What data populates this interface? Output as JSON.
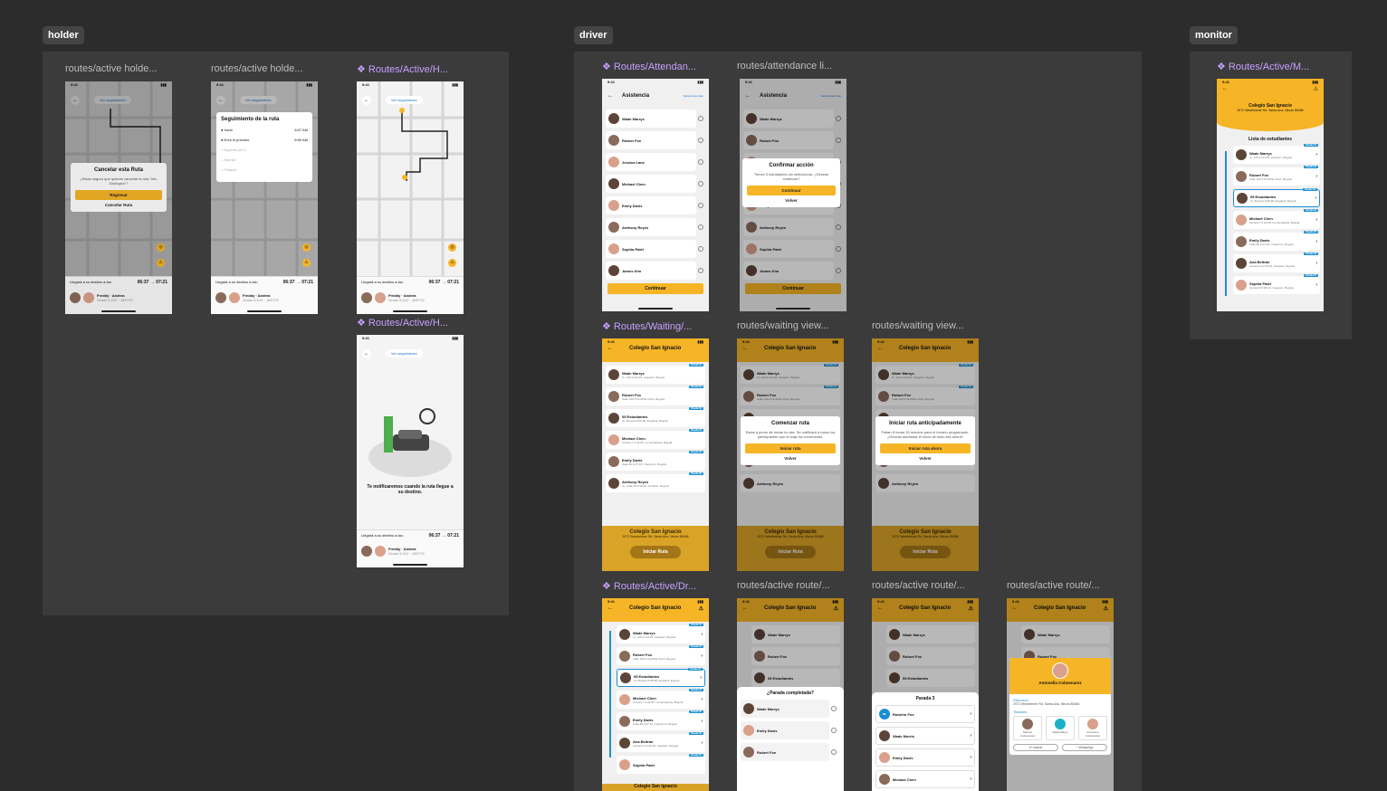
{
  "sections": {
    "holder": "holder",
    "driver": "driver",
    "monitor": "monitor"
  },
  "frame_labels": {
    "h1": "routes/active holde...",
    "h2": "routes/active holde...",
    "h3": "❖ Routes/Active/H...",
    "h4": "❖ Routes/Active/H...",
    "d1": "❖ Routes/Attendan...",
    "d2": "routes/attendance li...",
    "d3": "❖ Routes/Waiting/...",
    "d4": "routes/waiting view...",
    "d5": "routes/waiting view...",
    "d6": "❖ Routes/Active/Dr...",
    "d7": "routes/active route/...",
    "d8": "routes/active route/...",
    "d9": "routes/active route/...",
    "m1": "❖ Routes/Active/M..."
  },
  "status_time": "9:41",
  "map_pill": "Ver seguimiento",
  "holder_bottom": {
    "eta_label": "Llegará a su destino a las:",
    "eta_time": "06:37",
    "eta_time_end": "07:21",
    "names": "Freddy · Andrea",
    "sub": "Grado 5-012 · JAF/TG"
  },
  "cancel_modal": {
    "title": "Cancelar esta Ruta",
    "body": "¿Estás seguro que quieres cancelar la ruta \"Ida, Zoológico\"?",
    "primary": "Regresar",
    "secondary": "Cancelar Ruta"
  },
  "tracking": {
    "title": "Seguimiento de la ruta",
    "steps": [
      {
        "label": "Inició",
        "time": "6:07 AM"
      },
      {
        "label": "Eres el próximo",
        "time": "6:59 AM"
      },
      {
        "label": "Esperar por ti",
        "time": ""
      },
      {
        "label": "Abordó",
        "time": ""
      },
      {
        "label": "Finalizó",
        "time": ""
      }
    ]
  },
  "notify_text": "Te notificaremos cuando la ruta llegue a su destino.",
  "attendance": {
    "title": "Asistencia",
    "select_all": "Seleccionar todo",
    "students": [
      "Wade Marrys",
      "Robert Fox",
      "Jessica Lane",
      "Michael Chen",
      "Emily Davis",
      "Anthony Reyes",
      "Sophia Patel",
      "James Kim"
    ],
    "continue": "Continuar"
  },
  "confirm_modal": {
    "title": "Confirmar acción",
    "body": "Tienes 3 estudiantes sin seleccionar. ¿Deseas continuar?",
    "primary": "Continuar",
    "secondary": "Volver"
  },
  "waiting": {
    "school": "Colegio San Ignacio",
    "address": "2972 Westheimer Rd. Santa Ana, Illinois 85486",
    "start": "Iniciar Ruta",
    "stops": [
      {
        "name": "Wade Marrys",
        "addr": "Cr. 12b # 114-45, Usaquén, Bogotá",
        "badge": "Parada 01"
      },
      {
        "name": "Robert Fox",
        "addr": "Calle 100 # 19-08 El Chicó, Bogotá",
        "badge": "Parada 02"
      },
      {
        "name": "05 Estudiantes",
        "addr": "Av. Boyacá # 80-98, Engativá, Bogotá",
        "badge": "Parada 03"
      },
      {
        "name": "Michael Chen",
        "addr": "Carrera 7 # 24-05, La Candelaria, Bogotá",
        "badge": "Parada 04"
      },
      {
        "name": "Emily Davis",
        "addr": "Calle 80 # 27-32, Chapinero, Bogotá",
        "badge": "Parada 05"
      },
      {
        "name": "Anthony Reyes",
        "addr": "Av. Calle 26 # 69-40, Fontibón, Bogotá",
        "badge": "Parada 06"
      },
      {
        "name": "Sophia Patel",
        "addr": "",
        "badge": "Parada 07"
      }
    ]
  },
  "start_modal": {
    "title": "Comenzar ruta",
    "body": "Estás a punto de iniciar la ruta. Se notificará a todos los participantes que el viaje ha comenzado.",
    "primary": "Iniciar ruta",
    "secondary": "Volver"
  },
  "early_modal": {
    "title": "Iniciar ruta anticipadamente",
    "body": "Faltan 8 horas 15 minutos para el horario programado. ¿Deseas adelantar el inicio de esta ruta ahora?",
    "primary": "Iniciar ruta ahora",
    "secondary": "Volver"
  },
  "active": {
    "extra_stop": {
      "name": "Ana Beltrán",
      "addr": "Carrera 11 # 93-40, Usaquén, Bogotá"
    },
    "times": [
      "2:30PM",
      "2:45PM",
      "3:00PM",
      "3:15PM",
      "3:30PM",
      "4:00PM",
      "4:20PM"
    ]
  },
  "stop_done": {
    "title": "¿Parada completada?",
    "students": [
      "Wade Marrys",
      "Emily Davis",
      "Robert Fox"
    ]
  },
  "stop3": {
    "title": "Parada 3",
    "students": [
      "Roberto Fox",
      "Wade Morris",
      "Emily Davis",
      "Michael Chen"
    ],
    "initials": "RF"
  },
  "contact": {
    "name": "Antonella Colmenarez",
    "addr_label": "Dirección",
    "addr": "2972 Westheimer Rd. Santa Ana, Illinois 85486",
    "titular_label": "Titulares",
    "titulars": [
      "Salomé Colmenarez",
      "Wade Marys",
      "Francisco Colmenarez"
    ],
    "call": "Llamar",
    "whatsapp": "WhatsApp"
  },
  "monitor": {
    "list_title": "Lista de estudiantes",
    "extra": [
      {
        "name": "Ana Beltrán",
        "addr": "Carrera 11 # 93-40, Usaquén, Bogotá"
      },
      {
        "name": "Sophia Patel",
        "addr": "Carrera 9 # 98-33, Usaquén, Bogotá"
      }
    ]
  }
}
